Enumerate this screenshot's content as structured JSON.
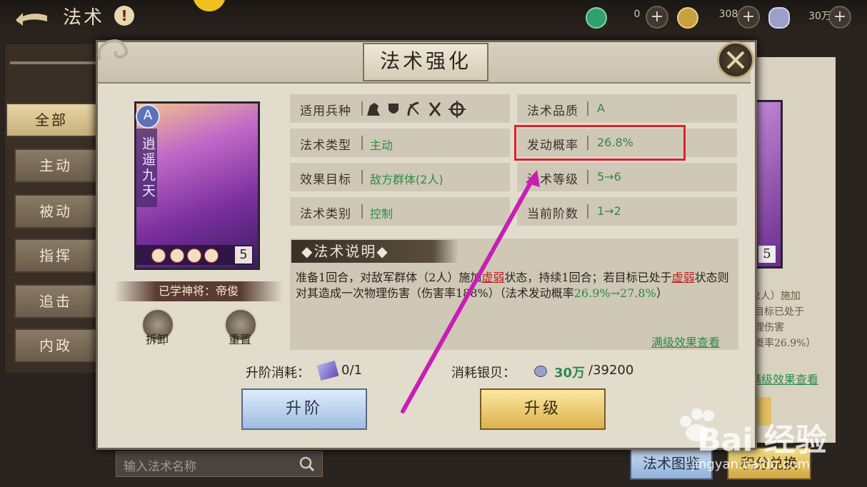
{
  "header": {
    "title": "法术",
    "warning_glyph": "!",
    "resources": [
      {
        "icon": "jade-icon",
        "value": "0",
        "color": "#2fa06a"
      },
      {
        "icon": "copper-coin-icon",
        "value": "308",
        "color": "#c9a040"
      },
      {
        "icon": "silver-shell-icon",
        "value": "30万",
        "color": "#9aa0c8"
      }
    ],
    "plus_glyph": "+"
  },
  "sidebar": {
    "items": [
      {
        "label": "全部",
        "active": true
      },
      {
        "label": "主动",
        "active": false
      },
      {
        "label": "被动",
        "active": false
      },
      {
        "label": "指挥",
        "active": false
      },
      {
        "label": "追击",
        "active": false
      },
      {
        "label": "内政",
        "active": false
      }
    ]
  },
  "search": {
    "placeholder": "输入法术名称"
  },
  "background_panel": {
    "card_level": "5",
    "desc_lines": [
      "（2人）施加",
      "若目标已处于",
      "物理伤害",
      "动概率26.9%）"
    ],
    "link": "满级效果查看",
    "button_left": "法术图鉴",
    "button_right": "积分兑换"
  },
  "modal": {
    "title": "法术强化",
    "card": {
      "grade": "A",
      "name": "逍遥九天",
      "level": "5",
      "star_glyph": "G",
      "stars": 4
    },
    "learned_by": "已学神将：帝俊",
    "buttons": {
      "dismantle": "拆卸",
      "reset": "重置"
    },
    "info": {
      "troop_label": "适用兵种",
      "troop_icons": [
        "cavalry-icon",
        "shield-icon",
        "bow-icon",
        "spear-icon",
        "siege-icon"
      ],
      "quality_label": "法术品质",
      "quality_value": "A",
      "type_label": "法术类型",
      "type_value": "主动",
      "chance_label": "发动概率",
      "chance_value": "26.8%",
      "target_label": "效果目标",
      "target_value": "敌方群体(2人)",
      "level_label": "法术等级",
      "level_value": "5→6",
      "category_label": "法术类别",
      "category_value": "控制",
      "stage_label": "当前阶数",
      "stage_value": "1→2"
    },
    "description": {
      "heading": "法术说明",
      "part1": "准备1回合，对敌军群体（2人）施加",
      "kw1": "虚弱",
      "part2": "状态，持续1回合；若目标已处于",
      "kw2": "虚弱",
      "part3": "状态则对其造成一次物理伤害（伤害率188%）（法术发动概率",
      "chance_change": "26.9%→27.8%",
      "part4": "）"
    },
    "full_effect_link": "满级效果查看",
    "advance_cost_label": "升阶消耗：",
    "advance_cost_value": "0/1",
    "silver_cost_label": "消耗银贝：",
    "silver_have": "30万",
    "silver_need": "/39200",
    "advance_button": "升阶",
    "upgrade_button": "升级"
  },
  "annotation": {
    "color": "#c81eb4",
    "highlight_color": "#e0202a"
  },
  "watermark": {
    "brand": "Bai 经验",
    "url": "jingyan.baidu.com"
  }
}
